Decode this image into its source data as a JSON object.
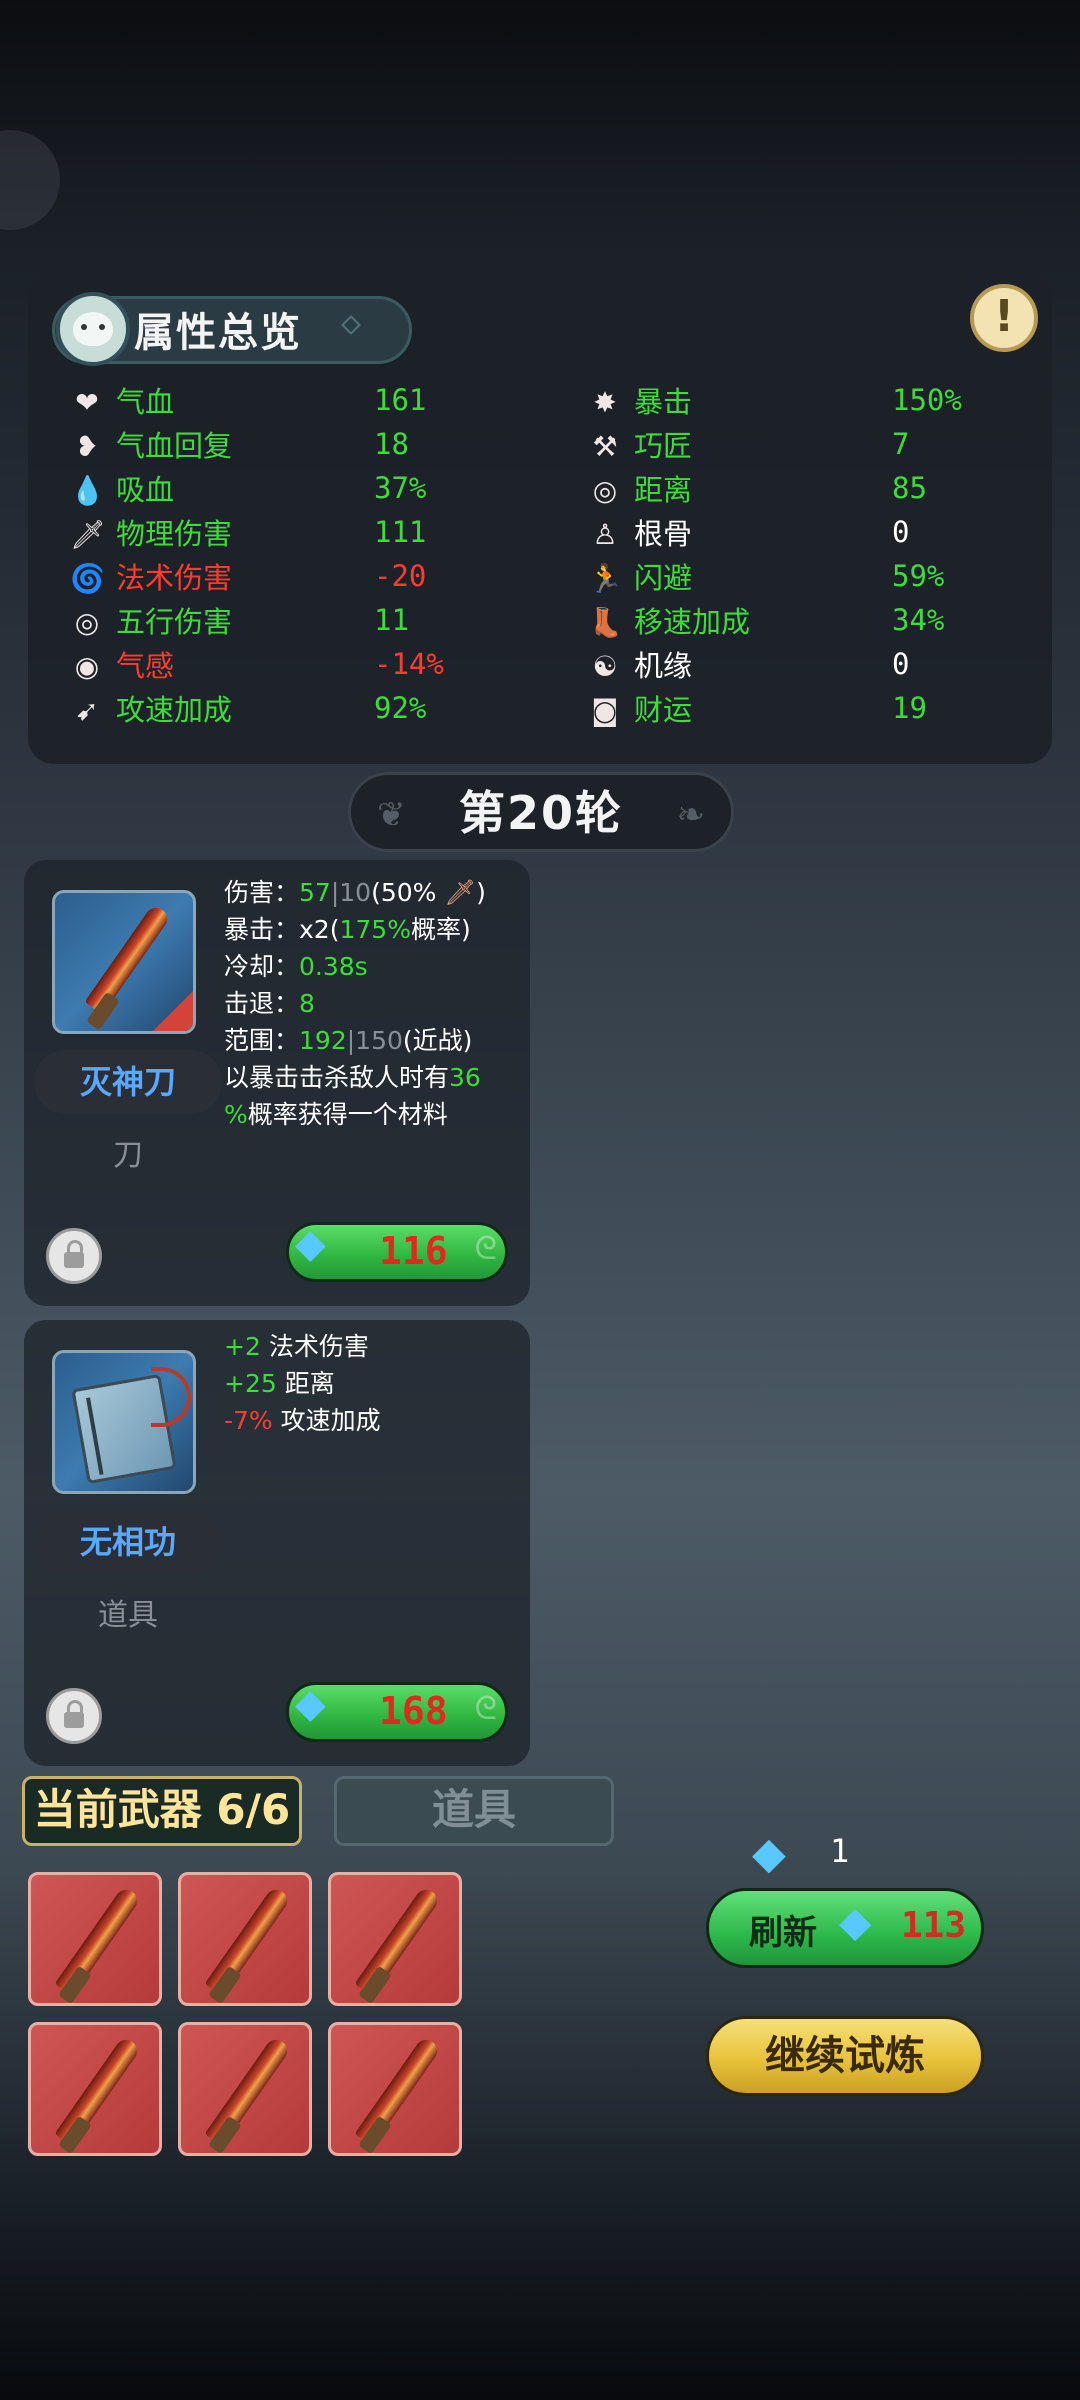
{
  "attributes": {
    "title": "属性总览",
    "info_label": "!",
    "left": [
      {
        "icon": "heart-icon",
        "glyph": "❤",
        "label": "气血",
        "value": "161",
        "tone": "green"
      },
      {
        "icon": "heart-regen-icon",
        "glyph": "❥",
        "label": "气血回复",
        "value": "18",
        "tone": "green"
      },
      {
        "icon": "drop-icon",
        "glyph": "💧",
        "label": "吸血",
        "value": "37%",
        "tone": "green"
      },
      {
        "icon": "sword-icon",
        "glyph": "🗡",
        "label": "物理伤害",
        "value": "111",
        "tone": "green"
      },
      {
        "icon": "spiral-icon",
        "glyph": "🌀",
        "label": "法术伤害",
        "value": "-20",
        "tone": "red"
      },
      {
        "icon": "elements-icon",
        "glyph": "◎",
        "label": "五行伤害",
        "value": "11",
        "tone": "green"
      },
      {
        "icon": "qi-sense-icon",
        "glyph": "◉",
        "label": "气感",
        "value": "-14%",
        "tone": "red"
      },
      {
        "icon": "attack-speed-icon",
        "glyph": "➹",
        "label": "攻速加成",
        "value": "92%",
        "tone": "green"
      }
    ],
    "right": [
      {
        "icon": "crit-icon",
        "glyph": "✸",
        "label": "暴击",
        "value": "150%",
        "tone": "green"
      },
      {
        "icon": "hammer-icon",
        "glyph": "⚒",
        "label": "巧匠",
        "value": "7",
        "tone": "green"
      },
      {
        "icon": "range-icon",
        "glyph": "◎",
        "label": "距离",
        "value": "85",
        "tone": "green"
      },
      {
        "icon": "physique-icon",
        "glyph": "♙",
        "label": "根骨",
        "value": "0",
        "tone": "white"
      },
      {
        "icon": "dodge-icon",
        "glyph": "🏃",
        "label": "闪避",
        "value": "59%",
        "tone": "green"
      },
      {
        "icon": "boot-icon",
        "glyph": "👢",
        "label": "移速加成",
        "value": "34%",
        "tone": "green"
      },
      {
        "icon": "fate-icon",
        "glyph": "☯",
        "label": "机缘",
        "value": "0",
        "tone": "white"
      },
      {
        "icon": "coin-icon",
        "glyph": "◙",
        "label": "财运",
        "value": "19",
        "tone": "green"
      }
    ]
  },
  "round": {
    "label": "第20轮"
  },
  "shop_items": [
    {
      "name": "灭神刀",
      "type": "刀",
      "price": "116",
      "desc": {
        "damage_label": "伤害：",
        "damage_value": "57",
        "damage_sep": "|",
        "damage_base": "10",
        "damage_pct": "(50%",
        "damage_close": ")",
        "crit_label": "暴击：",
        "crit_mult": "x2",
        "crit_open": "(",
        "crit_pct": "175%",
        "crit_close": "概率)",
        "cooldown_label": "冷却：",
        "cooldown_value": "0.38s",
        "knockback_label": "击退：",
        "knockback_value": "8",
        "range_label": "范围：",
        "range_value": "192",
        "range_sep": "|",
        "range_base": "150",
        "range_type": "(近战)",
        "effect_a": "以暴击击杀敌人时有",
        "effect_pct_a": "36",
        "effect_pct_b": "%",
        "effect_b": "概率获得一个材料"
      }
    },
    {
      "name": "无相功",
      "type": "道具",
      "price": "168",
      "desc": {
        "line1_value": "+2",
        "line1_label": "法术伤害",
        "line2_value": "+25",
        "line2_label": "距离",
        "line3_value": "-7%",
        "line3_label": "攻速加成"
      }
    }
  ],
  "tabs": {
    "weapons": "当前武器 6/6",
    "items": "道具"
  },
  "weapon_slots": [
    "灭神刀",
    "灭神刀",
    "灭神刀",
    "灭神刀",
    "灭神刀",
    "灭神刀"
  ],
  "currency": {
    "count": "1"
  },
  "refresh": {
    "label": "刷新",
    "cost": "113"
  },
  "continue": {
    "label": "继续试炼"
  },
  "colors": {
    "positive": "#3ddc3a",
    "negative": "#ff3b2f",
    "gem": "#58c8ff",
    "rarity_blue": "#58a9ff"
  }
}
